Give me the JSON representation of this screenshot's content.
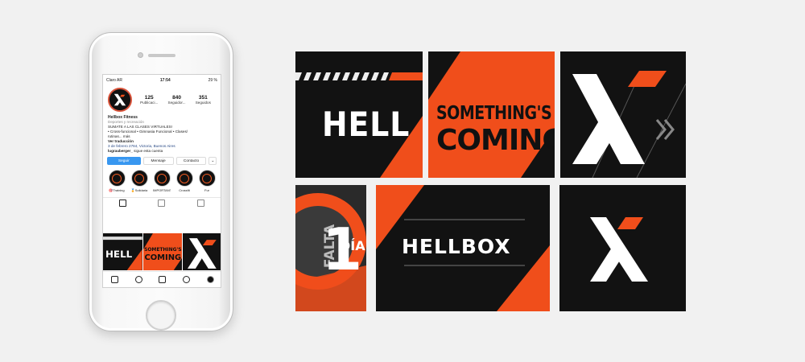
{
  "colors": {
    "brand_orange": "#f04e1b",
    "black": "#121212",
    "ig_blue": "#3897f0"
  },
  "status_bar": {
    "carrier": "Claro AR",
    "time": "17:54",
    "battery": "29 %"
  },
  "profile": {
    "stats": [
      {
        "value": "125",
        "label": "Publicaci..."
      },
      {
        "value": "840",
        "label": "Seguidor..."
      },
      {
        "value": "351",
        "label": "Seguidos"
      }
    ],
    "name": "Hellbox Fitness",
    "category": "Deportes y recreación",
    "bio_line1": "SUMATE A LAS CLASES VIRTUALES!",
    "bio_line2": "• Cross-funcional • Gimnasia Funcional • Clases/",
    "bio_line3": "rutinas... más",
    "translate": "Ver traducción",
    "address": "3 de febrero 2784, Victoria, Buenos Aires",
    "followed_by_user": "lugrauberger_",
    "followed_by_text": " sigue esta cuenta"
  },
  "buttons": {
    "follow": "Seguir",
    "message": "Mensaje",
    "contact": "Contacto",
    "more": "⌄"
  },
  "highlights": [
    "🎯Training",
    "🏅Solidaria",
    "IMPORTANTE",
    "Crossfit",
    "Fur"
  ],
  "posts": {
    "p1": {
      "text": "HELL"
    },
    "p2": {
      "line1": "SOMETHING'S",
      "line2": "COMING"
    },
    "p4": {
      "falta": "FALTA",
      "number": "1",
      "dia": "DÍA"
    },
    "p5": {
      "text": "HELLBOX"
    }
  },
  "mini_grid": {
    "hell": "HELL",
    "something": "SOMETHING'S",
    "coming": "COMING"
  }
}
